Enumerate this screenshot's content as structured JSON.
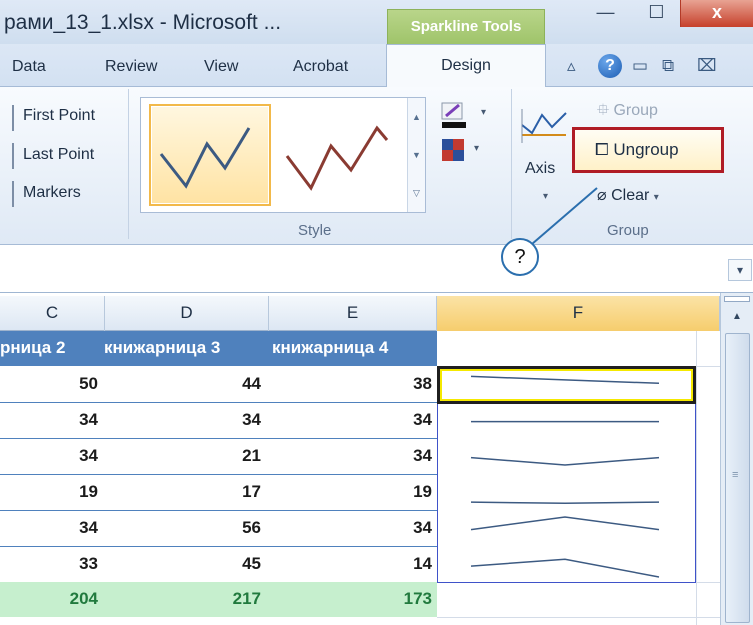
{
  "window": {
    "title": "рами_13_1.xlsx - Microsoft ...",
    "context_tab": "Sparkline Tools",
    "minimize": "—",
    "maximize": "☐",
    "close": "x"
  },
  "tabs": [
    "Data",
    "Review",
    "View",
    "Acrobat"
  ],
  "active_tab": "Design",
  "ribbon": {
    "show": [
      "First Point",
      "Last Point",
      "Markers"
    ],
    "style_group_label": "Style",
    "group_group_label": "Group",
    "axis_label": "Axis",
    "group_button": "Group",
    "ungroup_button": "Ungroup",
    "clear_button": "Clear"
  },
  "callout": "?",
  "columns": [
    "C",
    "D",
    "E",
    "F"
  ],
  "table": {
    "headers": [
      "рница 2",
      "книжарница 3",
      "книжарница 4"
    ],
    "rows": [
      [
        "50",
        "44",
        "38"
      ],
      [
        "34",
        "34",
        "34"
      ],
      [
        "34",
        "21",
        "34"
      ],
      [
        "19",
        "17",
        "19"
      ],
      [
        "34",
        "56",
        "34"
      ],
      [
        "33",
        "45",
        "14"
      ]
    ],
    "totals": [
      "204",
      "217",
      "173"
    ]
  },
  "colors": {
    "table_header": "#4f81bd",
    "total_fill": "#c6efce",
    "total_text": "#217a3e",
    "sparkline": "#3c5a82",
    "highlight": "#b01c25"
  }
}
